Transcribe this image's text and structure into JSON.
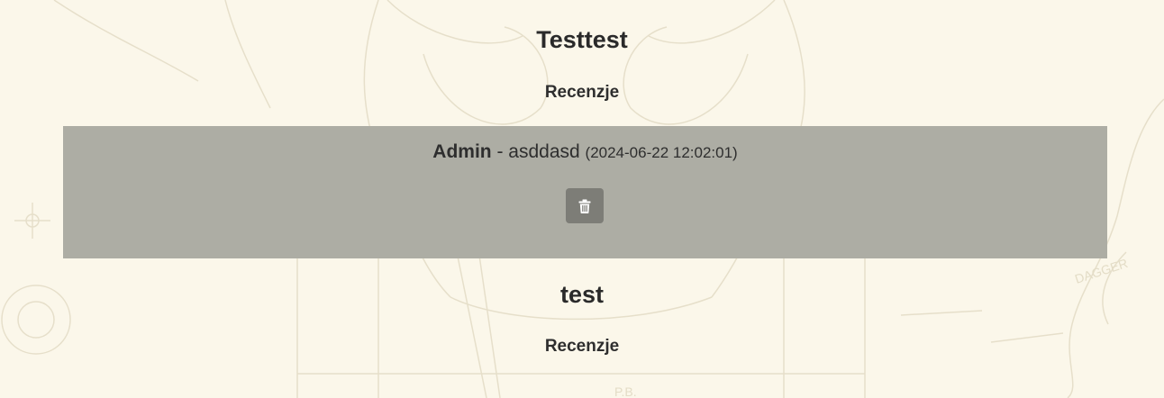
{
  "games": [
    {
      "title": "Testtest",
      "reviews_heading": "Recenzje",
      "reviews": [
        {
          "author": "Admin",
          "separator": " - ",
          "text": "asddasd",
          "date": "(2024-06-22 12:02:01)",
          "delete_icon": "trash-icon"
        }
      ]
    },
    {
      "title": "test",
      "reviews_heading": "Recenzje",
      "reviews": []
    }
  ],
  "colors": {
    "page_background": "#fbf7ea",
    "review_box": "#adada4",
    "delete_button": "#7d7d77",
    "text": "#2e2e2e"
  }
}
